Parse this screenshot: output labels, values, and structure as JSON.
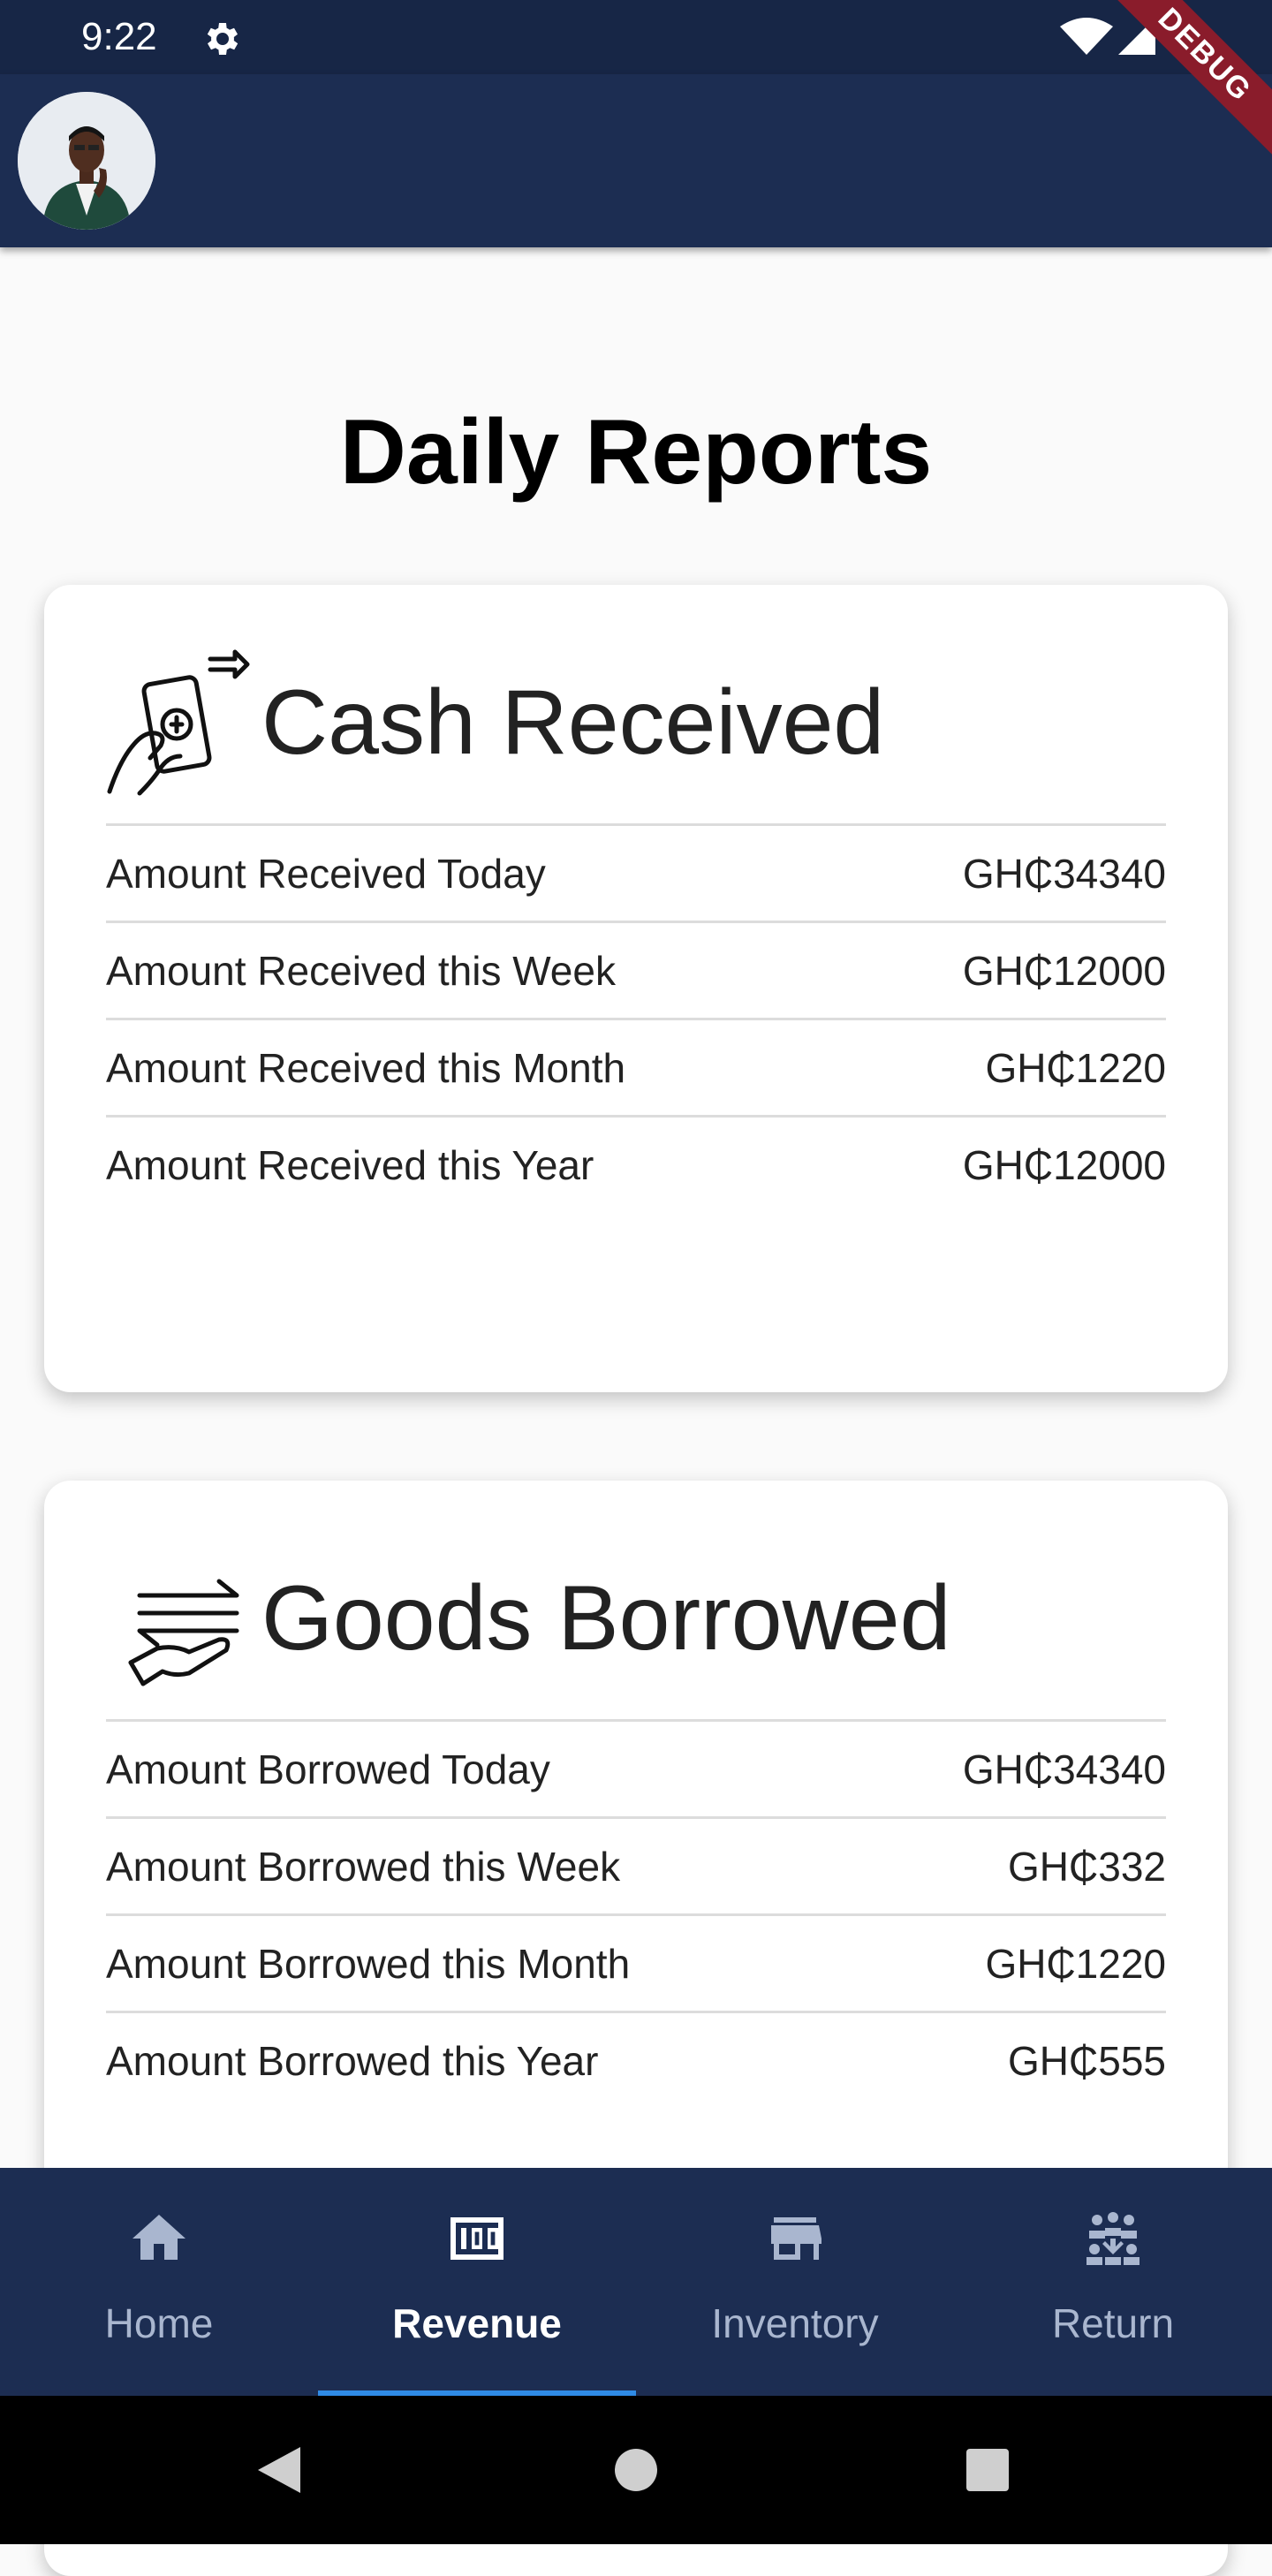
{
  "status_bar": {
    "time": "9:22",
    "debug_label": "DEBUG"
  },
  "app_bar": {
    "avatar_icon": "user-avatar"
  },
  "page": {
    "title": "Daily Reports"
  },
  "cards": {
    "cash_received": {
      "title": "Cash Received",
      "icon": "cash-hand-icon",
      "rows": [
        {
          "label": "Amount Received Today",
          "value": "GH₵34340"
        },
        {
          "label": "Amount Received this Week",
          "value": "GH₵12000"
        },
        {
          "label": "Amount Received this Month",
          "value": "GH₵1220"
        },
        {
          "label": "Amount Received this Year",
          "value": "GH₵12000"
        }
      ]
    },
    "goods_borrowed": {
      "title": "Goods Borrowed",
      "icon": "exchange-hand-icon",
      "rows": [
        {
          "label": "Amount Borrowed Today",
          "value": "GH₵34340"
        },
        {
          "label": "Amount Borrowed this Week",
          "value": "GH₵332"
        },
        {
          "label": "Amount Borrowed this Month",
          "value": "GH₵1220"
        },
        {
          "label": "Amount Borrowed this Year",
          "value": "GH₵555"
        }
      ]
    }
  },
  "bottom_nav": {
    "active": "Revenue",
    "accent_color": "#2f8be6",
    "items": [
      {
        "label": "Home",
        "icon": "home-icon"
      },
      {
        "label": "Revenue",
        "icon": "money-icon"
      },
      {
        "label": "Inventory",
        "icon": "store-icon"
      },
      {
        "label": "Return",
        "icon": "group-icon"
      }
    ]
  },
  "system_nav": {
    "buttons": [
      "back",
      "home",
      "recents"
    ]
  }
}
